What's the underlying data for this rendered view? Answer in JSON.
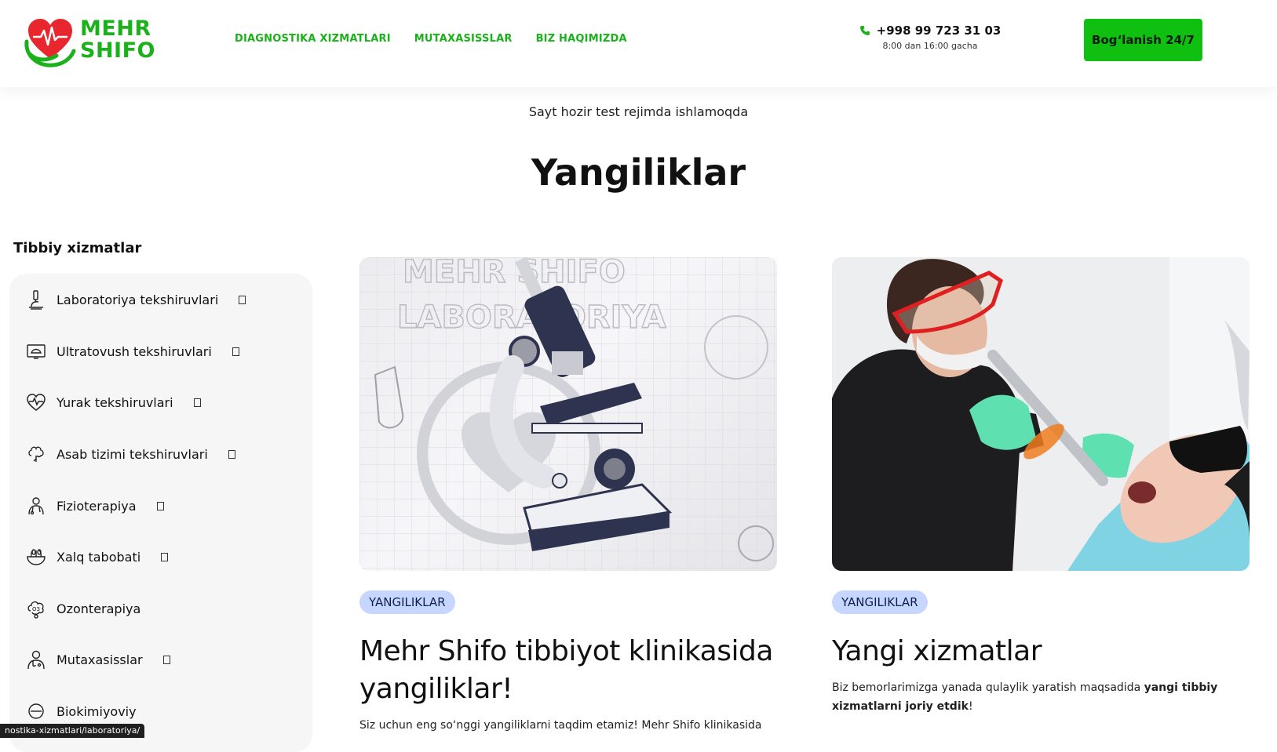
{
  "header": {
    "logo_line1": "MEHR",
    "logo_line2": "SHIFO",
    "nav": [
      "DIAGNOSTIKA XIZMATLARI",
      "MUTAXASISSLAR",
      "BIZ HAQIMIZDA"
    ],
    "phone": "+998 99 723 31 03",
    "hours": "8:00 dan 16:00 gacha",
    "cta": "Bog‘lanish 24/7"
  },
  "notice": "Sayt hozir test rejimda ishlamoqda",
  "page_title": "Yangiliklar",
  "sidebar": {
    "title": "Tibbiy xizmatlar",
    "items": [
      {
        "label": "Laboratoriya tekshiruvlari",
        "icon": "microscope-icon",
        "has_arrow": true
      },
      {
        "label": "Ultratovush tekshiruvlari",
        "icon": "ultrasound-icon",
        "has_arrow": true
      },
      {
        "label": "Yurak tekshiruvlari",
        "icon": "heart-pulse-icon",
        "has_arrow": true
      },
      {
        "label": "Asab tizimi tekshiruvlari",
        "icon": "brain-icon",
        "has_arrow": true
      },
      {
        "label": "Fizioterapiya",
        "icon": "physiotherapy-icon",
        "has_arrow": true
      },
      {
        "label": "Xalq tabobati",
        "icon": "herbal-bowl-icon",
        "has_arrow": true
      },
      {
        "label": "Ozonterapiya",
        "icon": "ozone-icon",
        "has_arrow": false
      },
      {
        "label": "Mutaxasisslar",
        "icon": "doctor-icon",
        "has_arrow": true
      },
      {
        "label": "Biokimiyoviy",
        "icon": "flask-icon",
        "has_arrow": false
      }
    ]
  },
  "cards": [
    {
      "image_text_1": "MEHR SHIFO",
      "image_text_2": "LABORATORIYA",
      "tag": "YANGILIKLAR",
      "title": "Mehr Shifo tibbiyot klinikasida yangiliklar!",
      "text": "Siz uchun eng so‘nggi yangiliklarni taqdim etamiz! Mehr Shifo klinikasida"
    },
    {
      "tag": "YANGILIKLAR",
      "title": "Yangi xizmatlar",
      "text_before": "Biz bemorlarimizga yanada qulaylik yaratish maqsadida ",
      "text_bold": "yangi tibbiy xizmatlarni joriy etdik",
      "text_after": "!"
    }
  ],
  "status_url": "nostika-xizmatlari/laboratoriya/",
  "colors": {
    "brand_green": "#1ab11a",
    "cta_green": "#10c010",
    "tag_bg": "#c7d6ff",
    "heart_red": "#e8262d"
  }
}
